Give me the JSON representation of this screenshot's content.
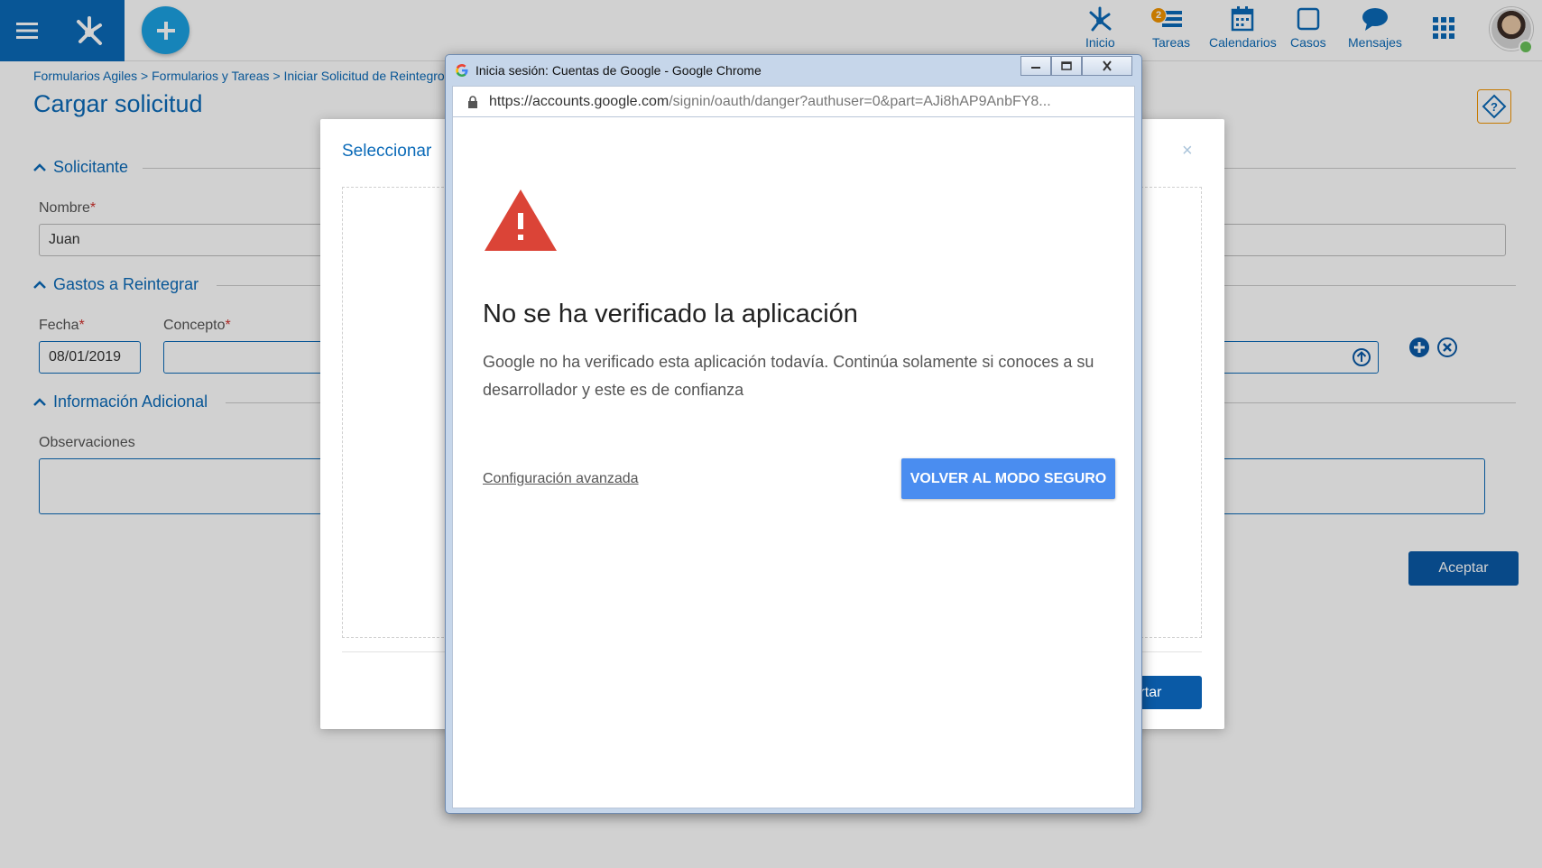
{
  "topbar": {
    "nav": [
      {
        "label": "Inicio",
        "icon": "network-icon"
      },
      {
        "label": "Tareas",
        "icon": "tasks-icon",
        "badge": "2"
      },
      {
        "label": "Calendarios",
        "icon": "calendar-icon"
      },
      {
        "label": "Casos",
        "icon": "cases-icon"
      },
      {
        "label": "Mensajes",
        "icon": "chat-icon"
      }
    ]
  },
  "breadcrumb": "Formularios Agiles > Formularios y Tareas > Iniciar Solicitud de Reintegros",
  "page_title": "Cargar solicitud",
  "sections": {
    "solicitante": "Solicitante",
    "gastos": "Gastos a Reintegrar",
    "info": "Información Adicional"
  },
  "fields": {
    "nombre_label": "Nombre",
    "nombre_value": "Juan",
    "fecha_label": "Fecha",
    "fecha_value": "08/01/2019",
    "concepto_label": "Concepto",
    "observaciones_label": "Observaciones",
    "required_mark": "*"
  },
  "aceptar_label": "Aceptar",
  "modal": {
    "title": "Seleccionar",
    "close": "×",
    "button_label": "ertar"
  },
  "chrome": {
    "title": "Inicia sesión: Cuentas de Google - Google Chrome",
    "url_host": "https://accounts.google.com",
    "url_path": "/signin/oauth/danger?authuser=0&part=AJi8hAP9AnbFY8...",
    "warning_title": "No se ha verificado la aplicación",
    "warning_text": "Google no ha verificado esta aplicación todavía. Continúa solamente si conoces a su desarrollador y este es de confianza",
    "advanced_link": "Configuración avanzada",
    "safe_button": "VOLVER AL MODO SEGURO"
  },
  "colors": {
    "brand_blue": "#0a6ab8",
    "accent_orange": "#f29400",
    "warning_red": "#db4437",
    "google_button": "#4a8df0"
  }
}
